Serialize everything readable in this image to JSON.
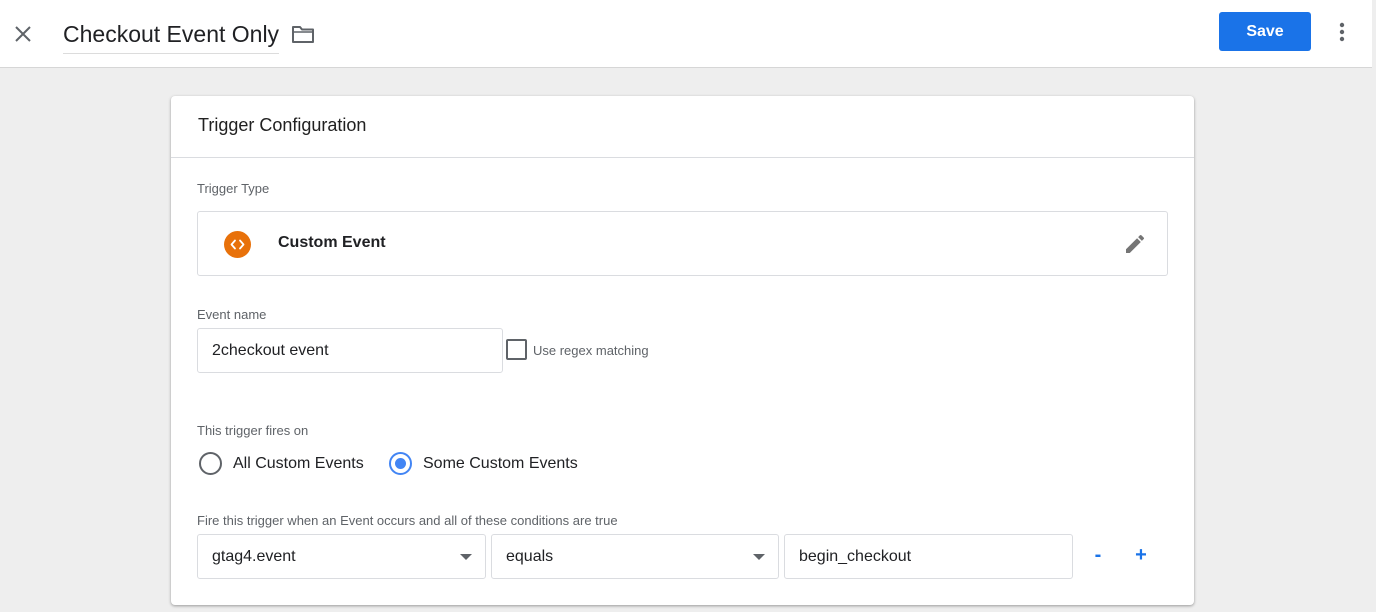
{
  "header": {
    "title": "Checkout Event Only",
    "save_label": "Save",
    "icons": [
      "close-icon",
      "folder-icon",
      "more-vert-icon"
    ]
  },
  "card": {
    "title": "Trigger Configuration",
    "trigger_type_label": "Trigger Type",
    "trigger_type_name": "Custom Event",
    "trigger_type_icon": "custom-event-code-icon",
    "event_name_label": "Event name",
    "event_name_value": "2checkout event",
    "regex_label": "Use regex matching",
    "regex_checked": false,
    "fires_on_label": "This trigger fires on",
    "fires_on_options": [
      {
        "label": "All Custom Events",
        "selected": false
      },
      {
        "label": "Some Custom Events",
        "selected": true
      }
    ],
    "conditions_label": "Fire this trigger when an Event occurs and all of these conditions are true",
    "condition": {
      "variable": "gtag4.event",
      "operator": "equals",
      "value": "begin_checkout",
      "remove_label": "-",
      "add_label": "+"
    }
  },
  "colors": {
    "accent": "#1a73e8",
    "radio": "#4285f4",
    "event_icon": "#e8710a",
    "background": "#eeeeee"
  }
}
